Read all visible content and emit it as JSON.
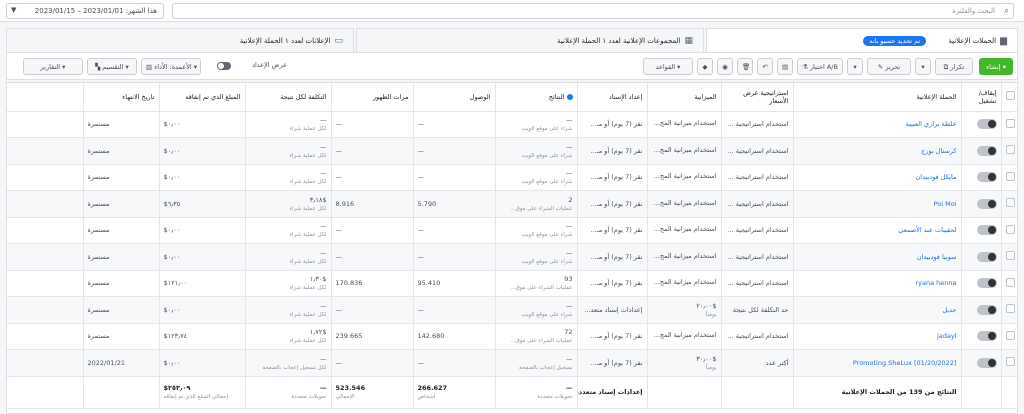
{
  "search": {
    "placeholder": "البحث والفلترة"
  },
  "date_range": "هذا الشهر: 2023/01/01 – 2023/01/15",
  "tabs": {
    "campaigns": "الحملات الإعلانية",
    "campaign_chip": "تم تحديد حسيو بانه",
    "adsets": "المجموعات الإعلانية لعدد ۱ الحملة الإعلانية",
    "ads": "الإعلانات لعدد ۱ الحملة الإعلانية"
  },
  "toolbar": {
    "create": "إنشاء",
    "duplicate": "تكرار",
    "edit": "تحرير",
    "ab_test": "اختبار A/B",
    "rules": "القواعد",
    "view_setup": "عرض الإعداد",
    "columns": "الأعمدة: الأداء",
    "breakdown": "التقسيم",
    "reports": "التقارير"
  },
  "columns": [
    "إيقاف/تشغيل",
    "الحملة الإعلانية",
    "استراتيجية عرض الأسعار",
    "الميزانية",
    "إعداد الإسناد",
    "النتائج",
    "الوصول",
    "مرات الظهور",
    "التكلفة لكل نتيجة",
    "المبلغ الذي تم إنفاقه",
    "تاريخ الانتهاء"
  ],
  "rows": [
    {
      "name": "خلطة براري العبيبة",
      "bid": "استخدام استراتيجية ...",
      "budget": "استخدام ميزانية المج...",
      "attr": "نقر (7 يوم) أو مـ...",
      "results": "—",
      "results_sub": "شراء على موقع الويب",
      "reach": "—",
      "impr": "—",
      "cpr": "—",
      "cpr_sub": "لكل عملية شراء",
      "spent": "$٠٫٠٠",
      "end": "مستمرة"
    },
    {
      "name": "كرستال بورج",
      "bid": "استخدام استراتيجية ...",
      "budget": "استخدام ميزانية المج...",
      "attr": "نقر (7 يوم) أو مـ...",
      "results": "—",
      "results_sub": "شراء على موقع الويب",
      "reach": "—",
      "impr": "—",
      "cpr": "—",
      "cpr_sub": "لكل عملية شراء",
      "spent": "$٠٫٠٠",
      "end": "مستمرة"
    },
    {
      "name": "مايكل فودبيدان",
      "bid": "استخدام استراتيجية ...",
      "budget": "استخدام ميزانية المج...",
      "attr": "نقر (7 يوم) أو مـ...",
      "results": "—",
      "results_sub": "شراء على موقع الويب",
      "reach": "—",
      "impr": "—",
      "cpr": "—",
      "cpr_sub": "لكل عملية شراء",
      "spent": "$٠٫٠٠",
      "end": "مستمرة"
    },
    {
      "name": "Poi Moi",
      "bid": "استخدام استراتيجية ...",
      "budget": "استخدام ميزانية المج...",
      "attr": "نقر (7 يوم) أو مـ...",
      "results": "2",
      "results_sub": "عمليات الشراء على موق...",
      "reach": "5.790",
      "impr": "8.916",
      "cpr": "$٣٫١٨",
      "cpr_sub": "لكل عملية شراء",
      "spent": "$٦٫٣٥",
      "end": "مستمرة"
    },
    {
      "name": "لحقيبات عبد الأصمعي",
      "bid": "استخدام استراتيجية ...",
      "budget": "استخدام ميزانية المج...",
      "attr": "نقر (7 يوم) أو مـ...",
      "results": "—",
      "results_sub": "شراء على موقع الويب",
      "reach": "—",
      "impr": "—",
      "cpr": "—",
      "cpr_sub": "لكل عملية شراء",
      "spent": "$٠٫٠٠",
      "end": "مستمرة"
    },
    {
      "name": "سوبيا فودبيدان",
      "bid": "استخدام استراتيجية ...",
      "budget": "استخدام ميزانية المج...",
      "attr": "نقر (7 يوم) أو مـ...",
      "results": "—",
      "results_sub": "شراء على موقع الويب",
      "reach": "—",
      "impr": "—",
      "cpr": "—",
      "cpr_sub": "لكل عملية شراء",
      "spent": "$٠٫٠٠",
      "end": "مستمرة"
    },
    {
      "name": "ryana henna",
      "bid": "استخدام استراتيجية ...",
      "budget": "استخدام ميزانية المج...",
      "attr": "نقر (7 يوم) أو مـ...",
      "results": "93",
      "results_sub": "عمليات الشراء على موق...",
      "reach": "95.410",
      "impr": "170.836",
      "cpr": "$١٫٣٠",
      "cpr_sub": "لكل عملية شراء",
      "spent": "$١٢١٫٠٠",
      "end": "مستمرة"
    },
    {
      "name": "جديل",
      "bid": "حد التكلفة لكل نتيجة",
      "budget": "$٢٠٫٠٠",
      "budget_sub": "يومياً",
      "attr": "إعدادات إسناد متعد...",
      "results": "—",
      "results_sub": "شراء على موقع الويب",
      "reach": "—",
      "impr": "—",
      "cpr": "—",
      "cpr_sub": "لكل عملية شراء",
      "spent": "$٠٫٠٠",
      "end": "مستمرة"
    },
    {
      "name": "jadayl",
      "bid": "استخدام استراتيجية ...",
      "budget": "استخدام ميزانية المج...",
      "attr": "نقر (7 يوم) أو مـ...",
      "results": "72",
      "results_sub": "عمليات الشراء على موق...",
      "reach": "142.680",
      "impr": "239.665",
      "cpr": "$١٫٧٢",
      "cpr_sub": "لكل عملية شراء",
      "spent": "$١٢٣٫٧٤",
      "end": "مستمرة"
    },
    {
      "name": "[01/20/2022] Promoting SheLux",
      "bid": "أكثر عدد",
      "budget": "$٣٠٫٠٠",
      "budget_sub": "يومياً",
      "attr": "نقر (7 يوم) أو مـ...",
      "results": "—",
      "results_sub": "تسجيل إعجاب بالصفحة",
      "reach": "—",
      "impr": "—",
      "cpr": "—",
      "cpr_sub": "لكل تسجيل إعجاب بالصفحة",
      "spent": "$٠٫٠٠",
      "end": "2022/01/21"
    }
  ],
  "total": {
    "label": "النتائج من 139 من الحملات الإعلانية",
    "attr": "إعدادات إسناد متعددة",
    "results": "—",
    "results_sub": "تحويلات متعددة",
    "reach": "266.627",
    "reach_sub": "أشخاص",
    "impr": "523.546",
    "impr_sub": "الإجمالي",
    "cpr": "—",
    "cpr_sub": "تحويلات متعددة",
    "spent": "$٢٥٣٫٠٩",
    "spent_sub": "إجمالي المبلغ الذي تم إنفاقه"
  }
}
